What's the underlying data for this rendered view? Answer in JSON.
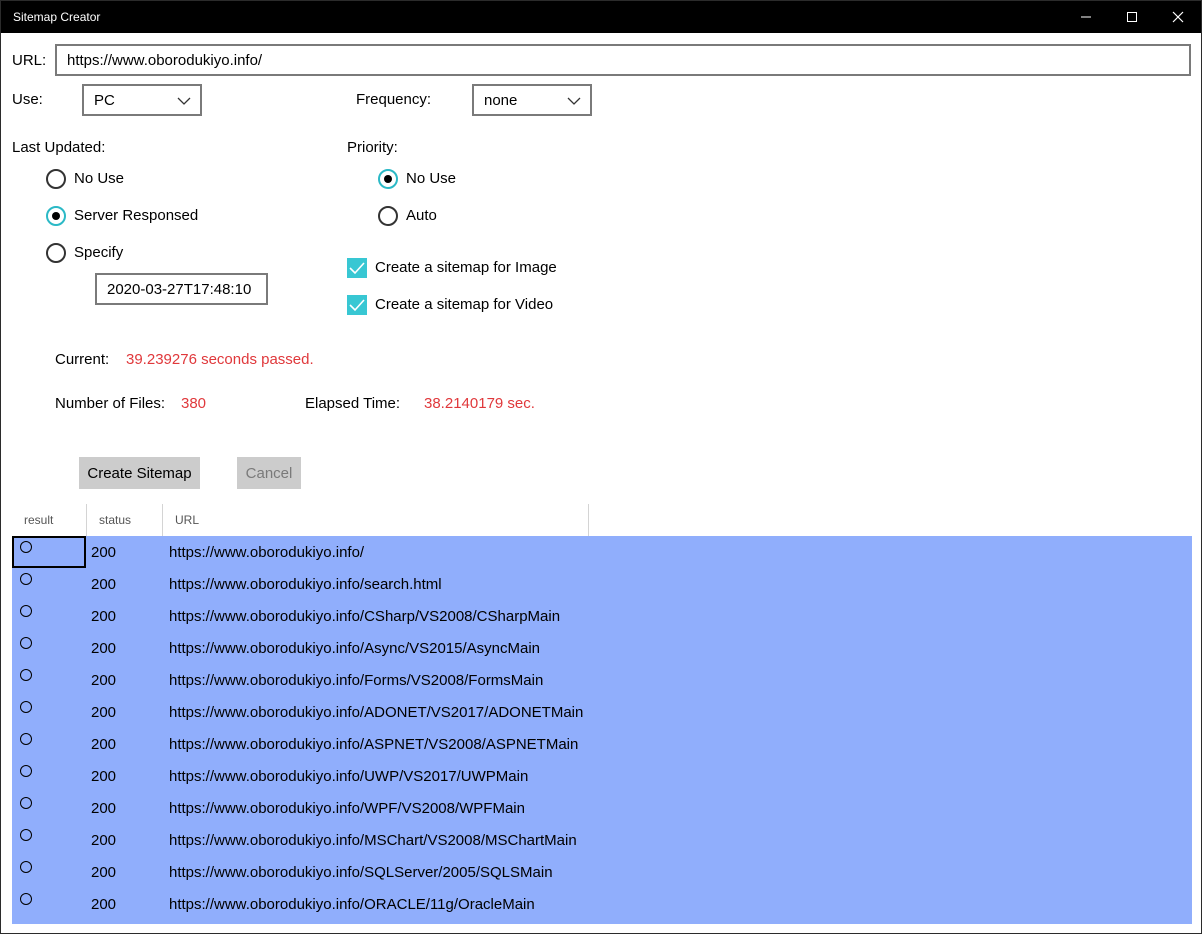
{
  "window": {
    "title": "Sitemap Creator"
  },
  "form": {
    "url_label": "URL:",
    "url_value": "https://www.oborodukiyo.info/",
    "use_label": "Use:",
    "use_value": "PC",
    "frequency_label": "Frequency:",
    "frequency_value": "none",
    "last_updated_label": "Last Updated:",
    "last_updated_options": [
      "No Use",
      "Server Responsed",
      "Specify"
    ],
    "last_updated_selected": "Server Responsed",
    "specify_datetime": "2020-03-27T17:48:10",
    "priority_label": "Priority:",
    "priority_options": [
      "No Use",
      "Auto"
    ],
    "priority_selected": "No Use",
    "image_sitemap_label": "Create a sitemap for Image",
    "image_sitemap_checked": true,
    "video_sitemap_label": "Create a sitemap for Video",
    "video_sitemap_checked": true
  },
  "status": {
    "current_label": "Current:",
    "current_value": "39.239276 seconds passed.",
    "files_label": "Number of Files:",
    "files_value": "380",
    "elapsed_label": "Elapsed Time:",
    "elapsed_value": "38.2140179 sec."
  },
  "buttons": {
    "create": "Create Sitemap",
    "cancel": "Cancel"
  },
  "grid": {
    "headers": [
      "result",
      "status",
      "URL"
    ],
    "rows": [
      {
        "status": "200",
        "url": "https://www.oborodukiyo.info/"
      },
      {
        "status": "200",
        "url": "https://www.oborodukiyo.info/search.html"
      },
      {
        "status": "200",
        "url": "https://www.oborodukiyo.info/CSharp/VS2008/CSharpMain"
      },
      {
        "status": "200",
        "url": "https://www.oborodukiyo.info/Async/VS2015/AsyncMain"
      },
      {
        "status": "200",
        "url": "https://www.oborodukiyo.info/Forms/VS2008/FormsMain"
      },
      {
        "status": "200",
        "url": "https://www.oborodukiyo.info/ADONET/VS2017/ADONETMain"
      },
      {
        "status": "200",
        "url": "https://www.oborodukiyo.info/ASPNET/VS2008/ASPNETMain"
      },
      {
        "status": "200",
        "url": "https://www.oborodukiyo.info/UWP/VS2017/UWPMain"
      },
      {
        "status": "200",
        "url": "https://www.oborodukiyo.info/WPF/VS2008/WPFMain"
      },
      {
        "status": "200",
        "url": "https://www.oborodukiyo.info/MSChart/VS2008/MSChartMain"
      },
      {
        "status": "200",
        "url": "https://www.oborodukiyo.info/SQLServer/2005/SQLSMain"
      },
      {
        "status": "200",
        "url": "https://www.oborodukiyo.info/ORACLE/11g/OracleMain"
      }
    ],
    "selection_color": "#90aefc"
  },
  "colors": {
    "accent": "#38c7d3",
    "value_red": "#e0383b"
  }
}
